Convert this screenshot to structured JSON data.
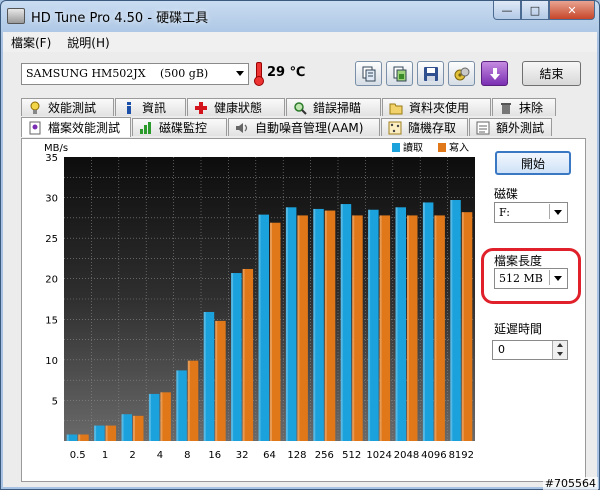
{
  "window": {
    "title": "HD Tune Pro 4.50 - 硬碟工具"
  },
  "menu": [
    "檔案(F)",
    "說明(H)"
  ],
  "toolbar": {
    "drive_name": "SAMSUNG HM502JX",
    "drive_size": "(500 gB)",
    "temperature": "29 ℃",
    "exit_label": "結束",
    "icons": [
      "copy-info-icon",
      "copy-screenshot-icon",
      "save-icon",
      "options-icon",
      "download-icon"
    ]
  },
  "tabs_top": [
    {
      "label": "效能測試",
      "icon": "lightbulb-icon"
    },
    {
      "label": "資訊",
      "icon": "info-icon"
    },
    {
      "label": "健康狀態",
      "icon": "health-cross-icon"
    },
    {
      "label": "錯誤掃瞄",
      "icon": "magnifier-icon"
    },
    {
      "label": "資料夾使用",
      "icon": "folder-icon"
    },
    {
      "label": "抹除",
      "icon": "trash-icon"
    }
  ],
  "tabs_bottom": [
    {
      "label": "檔案效能測試",
      "icon": "file-benchmark-icon",
      "active": true
    },
    {
      "label": "磁碟監控",
      "icon": "monitor-chart-icon"
    },
    {
      "label": "自動噪音管理(AAM)",
      "icon": "speaker-icon"
    },
    {
      "label": "隨機存取",
      "icon": "random-access-icon"
    },
    {
      "label": "額外測試",
      "icon": "extra-tests-icon"
    }
  ],
  "side": {
    "start_label": "開始",
    "disk_label": "磁碟",
    "disk_value": "F:",
    "file_length_label": "檔案長度",
    "file_length_value": "512 MB",
    "delay_label": "延遲時間",
    "delay_value": "0"
  },
  "watermark": "#705564",
  "chart_data": {
    "type": "bar",
    "ylabel": "MB/s",
    "ylim": [
      0,
      35
    ],
    "yticks": [
      5,
      10,
      15,
      20,
      25,
      30,
      35
    ],
    "categories": [
      "0.5",
      "1",
      "2",
      "4",
      "8",
      "16",
      "32",
      "64",
      "128",
      "256",
      "512",
      "1024",
      "2048",
      "4096",
      "8192"
    ],
    "series": [
      {
        "name": "讀取",
        "color": "#1ba2dc",
        "values": [
          0.8,
          1.9,
          3.3,
          5.8,
          8.7,
          15.9,
          20.7,
          27.9,
          28.8,
          28.6,
          29.2,
          28.5,
          28.8,
          29.4,
          29.7
        ]
      },
      {
        "name": "寫入",
        "color": "#e0781a",
        "values": [
          0.8,
          1.9,
          3.1,
          6.0,
          9.9,
          14.8,
          21.2,
          26.9,
          27.8,
          28.4,
          27.8,
          27.8,
          27.8,
          27.8,
          28.2
        ]
      }
    ],
    "grid": true,
    "legend": "top-right"
  }
}
